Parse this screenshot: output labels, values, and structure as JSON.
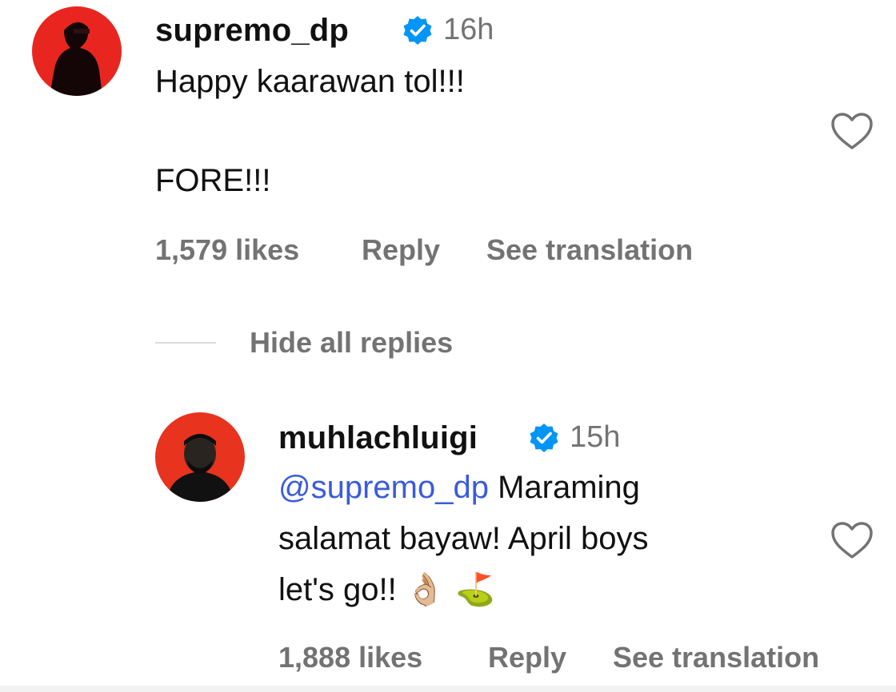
{
  "comment": {
    "username": "supremo_dp",
    "time": "16h",
    "text_line1": "Happy kaarawan tol!!!",
    "text_line2": "FORE!!!",
    "likes": "1,579 likes",
    "reply_label": "Reply",
    "translate_label": "See translation",
    "avatar_icon": "avatar-silhouette-red",
    "avatar_bg": "#e8261f"
  },
  "replies_toggle": {
    "label": "Hide all replies"
  },
  "reply": {
    "username": "muhlachluigi",
    "time": "15h",
    "mention": "@supremo_dp",
    "text_line1_rest": " Maraming",
    "text_line2": "salamat bayaw! April boys",
    "text_line3": "let's go!!",
    "emoji": "👌🏼 ⛳",
    "likes": "1,888 likes",
    "reply_label": "Reply",
    "translate_label": "See translation",
    "avatar_bg": "#e8331f"
  },
  "colors": {
    "verified_blue": "#0095f6",
    "mention_blue": "#3b5bdb",
    "meta_gray": "#737373"
  }
}
